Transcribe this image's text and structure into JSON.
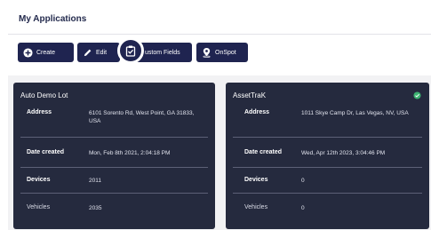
{
  "header": {
    "title": "My Applications"
  },
  "toolbar": {
    "create_label": "Create",
    "edit_label": "Edit",
    "fields_label": "ustom Fields",
    "onspot_label": "OnSpot"
  },
  "cards": [
    {
      "name": "Auto Demo Lot",
      "status": "",
      "rows": [
        {
          "key": "Address",
          "value": "6101 Sorento Rd, West Point, GA 31833, USA"
        },
        {
          "key": "Date created",
          "value": "Mon, Feb 8th 2021, 2:04:18 PM"
        },
        {
          "key": "Devices",
          "value": "2011"
        },
        {
          "key": "Vehicles",
          "value": "2035"
        }
      ]
    },
    {
      "name": "AssetTraK",
      "status": "active",
      "status_color": "#3cb371",
      "rows": [
        {
          "key": "Address",
          "value": "1011 Skye Camp Dr, Las Vegas, NV, USA"
        },
        {
          "key": "Date created",
          "value": "Wed, Apr 12th 2023, 3:04:46 PM"
        },
        {
          "key": "Devices",
          "value": "0"
        },
        {
          "key": "Vehicles",
          "value": "0"
        }
      ]
    }
  ],
  "colors": {
    "accent": "#1f2450",
    "card_bg": "#252a3e"
  }
}
